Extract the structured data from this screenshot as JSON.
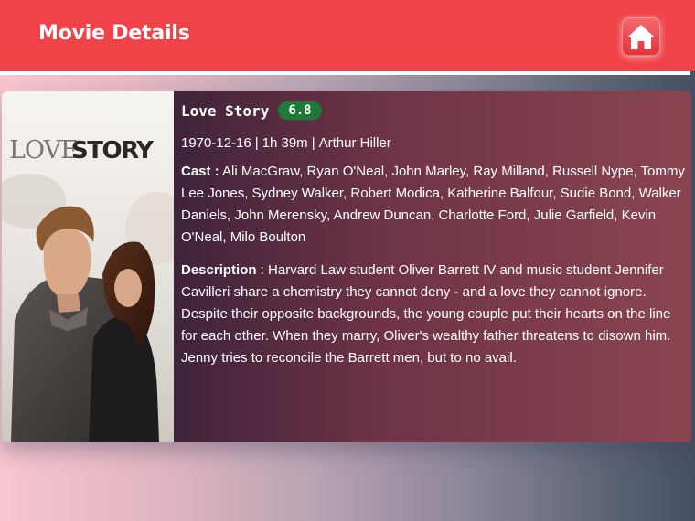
{
  "header": {
    "title": "Movie Details",
    "home_icon": "home-icon"
  },
  "movie": {
    "poster_text_love": "LOVE",
    "poster_text_story": "STORY",
    "title": "Love Story",
    "rating": "6.8",
    "release_date": "1970-12-16",
    "runtime": "1h 39m",
    "director": "Arthur Hiller",
    "cast_label": "Cast :",
    "cast": "Ali MacGraw, Ryan O'Neal, John Marley, Ray Milland, Russell Nype, Tommy Lee Jones, Sydney Walker, Robert Modica, Katherine Balfour, Sudie Bond, Walker Daniels, John Merensky, Andrew Duncan, Charlotte Ford, Julie Garfield, Kevin O'Neal, Milo Boulton",
    "description_label": "Description",
    "description": " : Harvard Law student Oliver Barrett IV and music student Jennifer Cavilleri share a chemistry they cannot deny - and a love they cannot ignore. Despite their opposite backgrounds, the young couple put their hearts on the line for each other. When they marry, Oliver's wealthy father threatens to disown him. Jenny tries to reconcile the Barrett men, but to no avail."
  },
  "colors": {
    "header_bg": "#f04349",
    "rating_bg": "#1f7a3a"
  }
}
